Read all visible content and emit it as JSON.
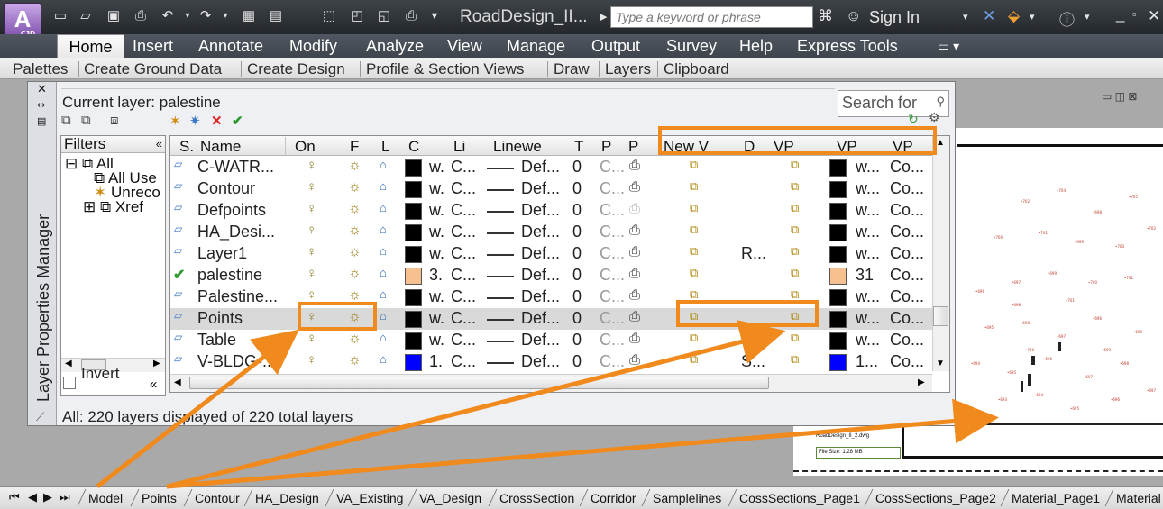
{
  "app": {
    "logo_text": "A",
    "logo_tag": "C3D",
    "doc_title": "RoadDesign_II...",
    "search_placeholder": "Type a keyword or phrase",
    "sign_in": "Sign In"
  },
  "ribbon": {
    "tabs": [
      "Home",
      "Insert",
      "Annotate",
      "Modify",
      "Analyze",
      "View",
      "Manage",
      "Output",
      "Survey",
      "Help",
      "Express Tools"
    ],
    "panels": [
      "Palettes",
      "Create Ground Data",
      "Create Design",
      "Profile & Section Views",
      "Draw",
      "Layers",
      "Clipboard"
    ]
  },
  "palette": {
    "title": "Layer Properties Manager",
    "current_layer": "Current layer: palestine",
    "search_placeholder": "Search for",
    "filters_header": "Filters",
    "tree": {
      "all": "All",
      "all_used": "All Use",
      "unreconciled": "Unreco",
      "xref": "Xref"
    },
    "invert_label": "Invert",
    "status": "All: 220 layers displayed of 220 total layers",
    "columns": [
      "S.",
      "Name",
      "On",
      "F",
      "L",
      "C",
      "Li",
      "Linewe",
      "T",
      "P",
      "P",
      "New V",
      "D",
      "VP",
      "VP",
      "VP"
    ],
    "rows": [
      {
        "name": "C-WATR...",
        "color_label": "w.",
        "color_hex": "#000000",
        "linetype": "C...",
        "lineweight": "Def...",
        "transparency": "0",
        "plot_style": "C...",
        "desc": "",
        "vp_color": "#000000",
        "vp_color_label": "w...",
        "vp_lt": "Co...",
        "current": false,
        "selected": false
      },
      {
        "name": "Contour",
        "color_label": "w.",
        "color_hex": "#000000",
        "linetype": "C...",
        "lineweight": "Def...",
        "transparency": "0",
        "plot_style": "C...",
        "desc": "",
        "vp_color": "#000000",
        "vp_color_label": "w...",
        "vp_lt": "Co...",
        "current": false,
        "selected": false
      },
      {
        "name": "Defpoints",
        "color_label": "w.",
        "color_hex": "#000000",
        "linetype": "C...",
        "lineweight": "Def...",
        "transparency": "0",
        "plot_style": "C...",
        "desc": "",
        "vp_color": "#000000",
        "vp_color_label": "w...",
        "vp_lt": "Co...",
        "current": false,
        "selected": false
      },
      {
        "name": "HA_Desi...",
        "color_label": "w.",
        "color_hex": "#000000",
        "linetype": "C...",
        "lineweight": "Def...",
        "transparency": "0",
        "plot_style": "C...",
        "desc": "",
        "vp_color": "#000000",
        "vp_color_label": "w...",
        "vp_lt": "Co...",
        "current": false,
        "selected": false
      },
      {
        "name": "Layer1",
        "color_label": "w.",
        "color_hex": "#000000",
        "linetype": "C...",
        "lineweight": "Def...",
        "transparency": "0",
        "plot_style": "C...",
        "desc": "R...",
        "vp_color": "#000000",
        "vp_color_label": "w...",
        "vp_lt": "Co...",
        "current": false,
        "selected": false
      },
      {
        "name": "palestine",
        "color_label": "3.",
        "color_hex": "#f7c08f",
        "linetype": "C...",
        "lineweight": "Def...",
        "transparency": "0",
        "plot_style": "C...",
        "desc": "",
        "vp_color": "#f7c08f",
        "vp_color_label": "31",
        "vp_lt": "Co...",
        "current": true,
        "selected": false
      },
      {
        "name": "Palestine...",
        "color_label": "w.",
        "color_hex": "#000000",
        "linetype": "C...",
        "lineweight": "Def...",
        "transparency": "0",
        "plot_style": "C...",
        "desc": "",
        "vp_color": "#000000",
        "vp_color_label": "w...",
        "vp_lt": "Co...",
        "current": false,
        "selected": false
      },
      {
        "name": "Points",
        "color_label": "w.",
        "color_hex": "#000000",
        "linetype": "C...",
        "lineweight": "Def...",
        "transparency": "0",
        "plot_style": "C...",
        "desc": "",
        "vp_color": "#000000",
        "vp_color_label": "w...",
        "vp_lt": "Co...",
        "current": false,
        "selected": true
      },
      {
        "name": "Table",
        "color_label": "w.",
        "color_hex": "#000000",
        "linetype": "C...",
        "lineweight": "Def...",
        "transparency": "0",
        "plot_style": "C...",
        "desc": "",
        "vp_color": "#000000",
        "vp_color_label": "w...",
        "vp_lt": "Co...",
        "current": false,
        "selected": false
      },
      {
        "name": "V-BLDG-...",
        "color_label": "1.",
        "color_hex": "#0000ff",
        "linetype": "C...",
        "lineweight": "Def...",
        "transparency": "0",
        "plot_style": "C...",
        "desc": "S...",
        "vp_color": "#0000ff",
        "vp_color_label": "1...",
        "vp_lt": "Co...",
        "current": false,
        "selected": false
      }
    ]
  },
  "viewport": {
    "title_block_name": "RoadDesign_II_2.dwg",
    "title_block_size": "File Size: 1.28 MB"
  },
  "layout_tabs": [
    "Model",
    "Points",
    "Contour",
    "HA_Design",
    "VA_Existing",
    "VA_Design",
    "CrossSection",
    "Corridor",
    "Samplelines",
    "CossSections_Page1",
    "CossSections_Page2",
    "Material_Page1",
    "Material"
  ],
  "colors": {
    "annotation": "#f08a1c",
    "title_bar": "#2f3439",
    "ribbon_bg": "#474d55"
  }
}
